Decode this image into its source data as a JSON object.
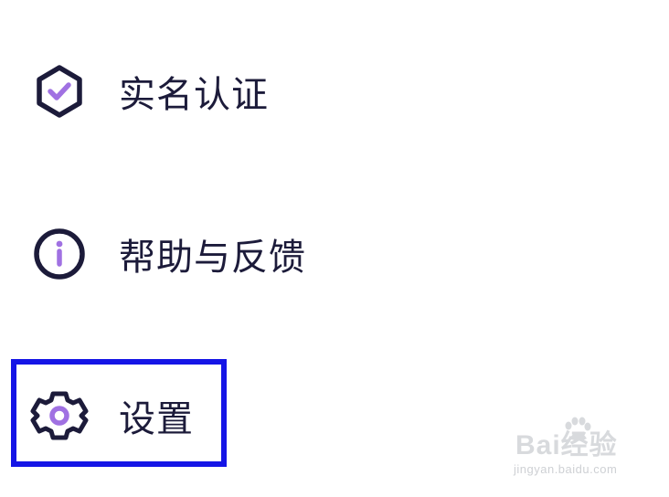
{
  "menu": {
    "items": [
      {
        "label": "实名认证",
        "icon": "shield-check-icon"
      },
      {
        "label": "帮助与反馈",
        "icon": "info-circle-icon"
      },
      {
        "label": "设置",
        "icon": "gear-icon"
      }
    ]
  },
  "highlight": {
    "target": "settings",
    "color": "#1515e6"
  },
  "colors": {
    "icon_outline": "#1c1b3a",
    "icon_accent": "#a071e2",
    "text": "#1c1b3a"
  },
  "watermark": {
    "brand": "Bai经验",
    "url": "jingyan.baidu.com"
  }
}
